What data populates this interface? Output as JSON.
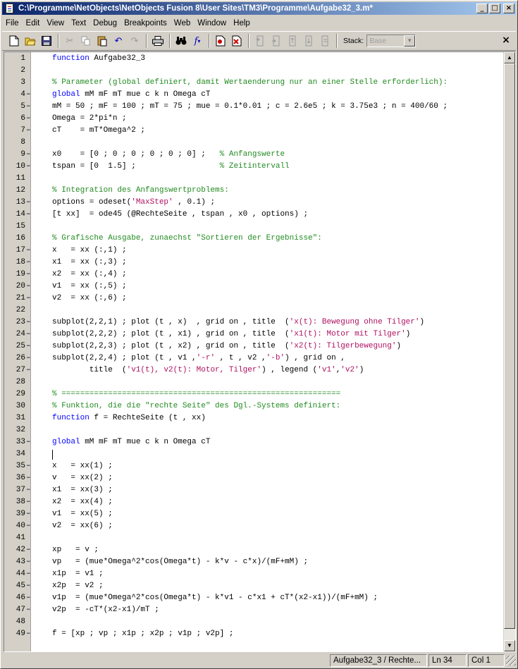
{
  "window": {
    "title": "C:\\Programme\\NetObjects\\NetObjects Fusion 8\\User Sites\\TM3\\Programme\\Aufgabe32_3.m*",
    "minimize": "_",
    "maximize": "□",
    "close": "×"
  },
  "menu": [
    "File",
    "Edit",
    "View",
    "Text",
    "Debug",
    "Breakpoints",
    "Web",
    "Window",
    "Help"
  ],
  "toolbar": {
    "stack_label": "Stack:",
    "stack_value": "Base",
    "close_doc": "×"
  },
  "editor": {
    "cursor_line": 34,
    "lines": [
      {
        "n": "1",
        "dash": false,
        "segs": [
          [
            "kw",
            "function"
          ],
          [
            "t",
            " Aufgabe32_3"
          ]
        ]
      },
      {
        "n": "2",
        "dash": false,
        "segs": []
      },
      {
        "n": "3",
        "dash": false,
        "segs": [
          [
            "cm",
            "% Parameter (global definiert, damit Wertaenderung nur an einer Stelle erforderlich):"
          ]
        ]
      },
      {
        "n": "4",
        "dash": true,
        "segs": [
          [
            "kw",
            "global"
          ],
          [
            "t",
            " mM mF mT mue c k n Omega cT"
          ]
        ]
      },
      {
        "n": "5",
        "dash": true,
        "segs": [
          [
            "t",
            "mM = 50 ; mF = 100 ; mT = 75 ; mue = 0.1*0.01 ; c = 2.6e5 ; k = 3.75e3 ; n = 400/60 ;"
          ]
        ]
      },
      {
        "n": "6",
        "dash": true,
        "segs": [
          [
            "t",
            "Omega = 2*pi*n ;"
          ]
        ]
      },
      {
        "n": "7",
        "dash": true,
        "segs": [
          [
            "t",
            "cT    = mT*Omega^2 ;"
          ]
        ]
      },
      {
        "n": "8",
        "dash": false,
        "segs": []
      },
      {
        "n": "9",
        "dash": true,
        "segs": [
          [
            "t",
            "x0    = [0 ; 0 ; 0 ; 0 ; 0 ; 0] ;   "
          ],
          [
            "cm",
            "% Anfangswerte"
          ]
        ]
      },
      {
        "n": "10",
        "dash": true,
        "segs": [
          [
            "t",
            "tspan = [0  1.5] ;                  "
          ],
          [
            "cm",
            "% Zeitintervall"
          ]
        ]
      },
      {
        "n": "11",
        "dash": false,
        "segs": []
      },
      {
        "n": "12",
        "dash": false,
        "segs": [
          [
            "cm",
            "% Integration des Anfangswertproblems:"
          ]
        ]
      },
      {
        "n": "13",
        "dash": true,
        "segs": [
          [
            "t",
            "options = odeset("
          ],
          [
            "st",
            "'MaxStep'"
          ],
          [
            "t",
            " , 0.1) ;"
          ]
        ]
      },
      {
        "n": "14",
        "dash": true,
        "segs": [
          [
            "t",
            "[t xx]  = ode45 (@RechteSeite , tspan , x0 , options) ;"
          ]
        ]
      },
      {
        "n": "15",
        "dash": false,
        "segs": []
      },
      {
        "n": "16",
        "dash": false,
        "segs": [
          [
            "cm",
            "% Grafische Ausgabe, zunaechst \"Sortieren der Ergebnisse\":"
          ]
        ]
      },
      {
        "n": "17",
        "dash": true,
        "segs": [
          [
            "t",
            "x   = xx (:,1) ;"
          ]
        ]
      },
      {
        "n": "18",
        "dash": true,
        "segs": [
          [
            "t",
            "x1  = xx (:,3) ;"
          ]
        ]
      },
      {
        "n": "19",
        "dash": true,
        "segs": [
          [
            "t",
            "x2  = xx (:,4) ;"
          ]
        ]
      },
      {
        "n": "20",
        "dash": true,
        "segs": [
          [
            "t",
            "v1  = xx (:,5) ;"
          ]
        ]
      },
      {
        "n": "21",
        "dash": true,
        "segs": [
          [
            "t",
            "v2  = xx (:,6) ;"
          ]
        ]
      },
      {
        "n": "22",
        "dash": false,
        "segs": []
      },
      {
        "n": "23",
        "dash": true,
        "segs": [
          [
            "t",
            "subplot(2,2,1) ; plot (t , x)  , grid on , title  ("
          ],
          [
            "st",
            "'x(t): Bewegung ohne Tilger'"
          ],
          [
            "t",
            ")"
          ]
        ]
      },
      {
        "n": "24",
        "dash": true,
        "segs": [
          [
            "t",
            "subplot(2,2,2) ; plot (t , x1) , grid on , title  ("
          ],
          [
            "st",
            "'x1(t): Motor mit Tilger'"
          ],
          [
            "t",
            ")"
          ]
        ]
      },
      {
        "n": "25",
        "dash": true,
        "segs": [
          [
            "t",
            "subplot(2,2,3) ; plot (t , x2) , grid on , title  ("
          ],
          [
            "st",
            "'x2(t): Tilgerbewegung'"
          ],
          [
            "t",
            ")"
          ]
        ]
      },
      {
        "n": "26",
        "dash": true,
        "segs": [
          [
            "t",
            "subplot(2,2,4) ; plot (t , v1 ,"
          ],
          [
            "st",
            "'-r'"
          ],
          [
            "t",
            " , t , v2 ,"
          ],
          [
            "st",
            "'-b'"
          ],
          [
            "t",
            ") , grid on ,"
          ]
        ]
      },
      {
        "n": "27",
        "dash": true,
        "segs": [
          [
            "t",
            "        title  ("
          ],
          [
            "st",
            "'v1(t), v2(t): Motor, Tilger'"
          ],
          [
            "t",
            ") , legend ("
          ],
          [
            "st",
            "'v1'"
          ],
          [
            "t",
            ","
          ],
          [
            "st",
            "'v2'"
          ],
          [
            "t",
            ")"
          ]
        ]
      },
      {
        "n": "28",
        "dash": false,
        "segs": []
      },
      {
        "n": "29",
        "dash": false,
        "segs": [
          [
            "cm",
            "% ============================================================"
          ]
        ]
      },
      {
        "n": "30",
        "dash": false,
        "segs": [
          [
            "cm",
            "% Funktion, die die \"rechte Seite\" des Dgl.-Systems definiert:"
          ]
        ]
      },
      {
        "n": "31",
        "dash": false,
        "segs": [
          [
            "kw",
            "function"
          ],
          [
            "t",
            " f = RechteSeite (t , xx)"
          ]
        ]
      },
      {
        "n": "32",
        "dash": false,
        "segs": []
      },
      {
        "n": "33",
        "dash": true,
        "segs": [
          [
            "kw",
            "global"
          ],
          [
            "t",
            " mM mF mT mue c k n Omega cT"
          ]
        ]
      },
      {
        "n": "34",
        "dash": false,
        "segs": []
      },
      {
        "n": "35",
        "dash": true,
        "segs": [
          [
            "t",
            "x   = xx(1) ;"
          ]
        ]
      },
      {
        "n": "36",
        "dash": true,
        "segs": [
          [
            "t",
            "v   = xx(2) ;"
          ]
        ]
      },
      {
        "n": "37",
        "dash": true,
        "segs": [
          [
            "t",
            "x1  = xx(3) ;"
          ]
        ]
      },
      {
        "n": "38",
        "dash": true,
        "segs": [
          [
            "t",
            "x2  = xx(4) ;"
          ]
        ]
      },
      {
        "n": "39",
        "dash": true,
        "segs": [
          [
            "t",
            "v1  = xx(5) ;"
          ]
        ]
      },
      {
        "n": "40",
        "dash": true,
        "segs": [
          [
            "t",
            "v2  = xx(6) ;"
          ]
        ]
      },
      {
        "n": "41",
        "dash": false,
        "segs": []
      },
      {
        "n": "42",
        "dash": true,
        "segs": [
          [
            "t",
            "xp   = v ;"
          ]
        ]
      },
      {
        "n": "43",
        "dash": true,
        "segs": [
          [
            "t",
            "vp   = (mue*Omega^2*cos(Omega*t) - k*v - c*x)/(mF+mM) ;"
          ]
        ]
      },
      {
        "n": "44",
        "dash": true,
        "segs": [
          [
            "t",
            "x1p  = v1 ;"
          ]
        ]
      },
      {
        "n": "45",
        "dash": true,
        "segs": [
          [
            "t",
            "x2p  = v2 ;"
          ]
        ]
      },
      {
        "n": "46",
        "dash": true,
        "segs": [
          [
            "t",
            "v1p  = (mue*Omega^2*cos(Omega*t) - k*v1 - c*x1 + cT*(x2-x1))/(mF+mM) ;"
          ]
        ]
      },
      {
        "n": "47",
        "dash": true,
        "segs": [
          [
            "t",
            "v2p  = -cT*(x2-x1)/mT ;"
          ]
        ]
      },
      {
        "n": "48",
        "dash": false,
        "segs": []
      },
      {
        "n": "49",
        "dash": true,
        "segs": [
          [
            "t",
            "f = [xp ; vp ; x1p ; x2p ; v1p ; v2p] ;"
          ]
        ]
      }
    ]
  },
  "status": {
    "function": "Aufgabe32_3 / Rechte...",
    "line": "Ln 34",
    "col": "Col 1"
  },
  "colors": {
    "keyword": "#0000ff",
    "comment": "#228b22",
    "string": "#b01060",
    "titlebar_start": "#0a246a",
    "titlebar_end": "#a6caf0"
  }
}
